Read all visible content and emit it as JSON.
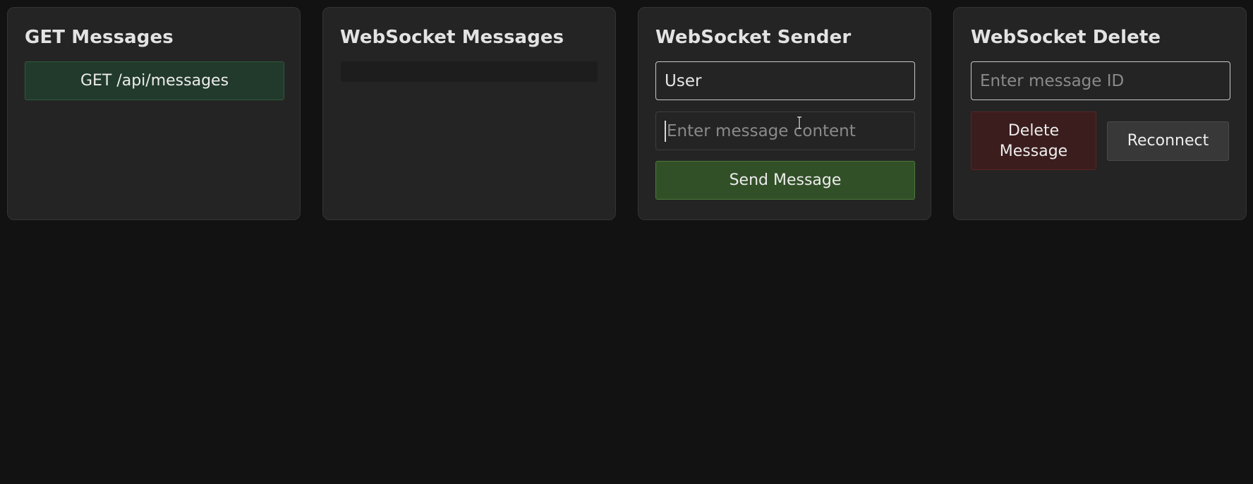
{
  "panels": {
    "get": {
      "title": "GET Messages",
      "button_label": "GET /api/messages"
    },
    "ws_messages": {
      "title": "WebSocket Messages"
    },
    "sender": {
      "title": "WebSocket Sender",
      "user_value": "User",
      "content_placeholder": "Enter message content",
      "send_label": "Send Message"
    },
    "delete": {
      "title": "WebSocket Delete",
      "id_placeholder": "Enter message ID",
      "delete_label": "Delete Message",
      "reconnect_label": "Reconnect"
    }
  },
  "colors": {
    "background": "#121212",
    "panel": "#242424",
    "get_button": "#223a2c",
    "send_button": "#325028",
    "delete_button": "#3b1d1d",
    "reconnect_button": "#383838"
  },
  "icons": {
    "cursor": "text-cursor-icon"
  }
}
